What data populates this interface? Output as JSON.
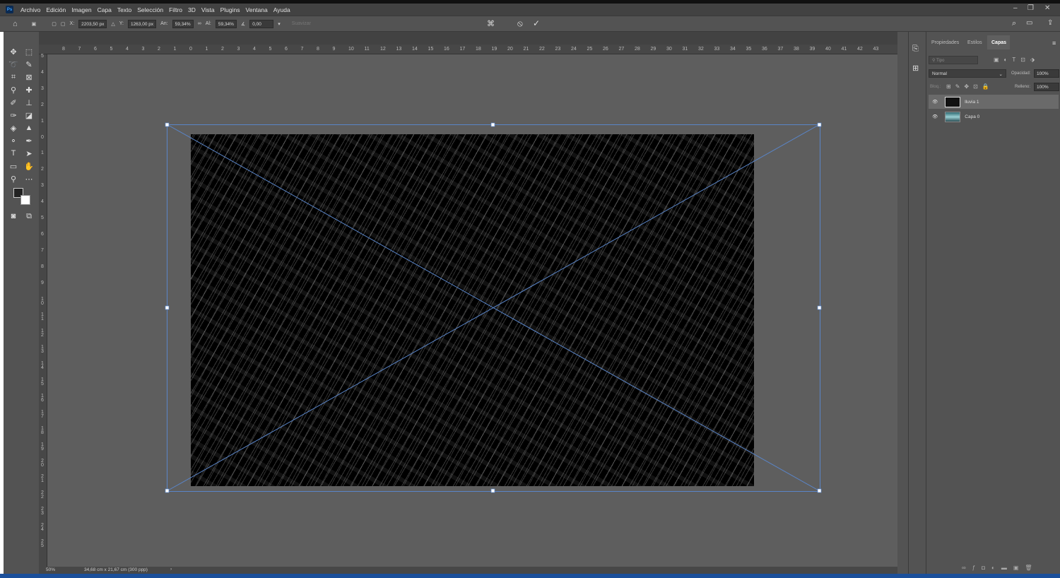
{
  "app": {
    "logo": "Ps"
  },
  "menu": [
    "Archivo",
    "Edición",
    "Imagen",
    "Capa",
    "Texto",
    "Selección",
    "Filtro",
    "3D",
    "Vista",
    "Plugins",
    "Ventana",
    "Ayuda"
  ],
  "options": {
    "x_label": "X:",
    "x_value": "2203,50 px",
    "y_label": "Y:",
    "y_value": "1263,00 px",
    "w_label": "An:",
    "w_value": "59,34%",
    "h_label": "Al:",
    "h_value": "59,34%",
    "angle_value": "0,00",
    "smooth_label": "Suavizar"
  },
  "rulers": {
    "horizontal": [
      "8",
      "7",
      "6",
      "5",
      "4",
      "3",
      "2",
      "1",
      "0",
      "1",
      "2",
      "3",
      "4",
      "5",
      "6",
      "7",
      "8",
      "9",
      "10",
      "11",
      "12",
      "13",
      "14",
      "15",
      "16",
      "17",
      "18",
      "19",
      "20",
      "21",
      "22",
      "23",
      "24",
      "25",
      "26",
      "27",
      "28",
      "29",
      "30",
      "31",
      "32",
      "33",
      "34",
      "35",
      "36",
      "37",
      "38",
      "39",
      "40",
      "41",
      "42",
      "43"
    ],
    "vertical": [
      "5",
      "4",
      "3",
      "2",
      "1",
      "0",
      "1",
      "2",
      "3",
      "4",
      "5",
      "6",
      "7",
      "8",
      "9",
      "10",
      "11",
      "12",
      "13",
      "14",
      "15",
      "16",
      "17",
      "18",
      "19",
      "20",
      "21",
      "22",
      "23",
      "24",
      "25"
    ]
  },
  "status": {
    "zoom": "50%",
    "doc_size": "34,68 cm x 21,67 cm (300 ppp)"
  },
  "panel": {
    "tabs": [
      "Propiedades",
      "Estilos",
      "Capas"
    ],
    "active_tab": "Capas",
    "filter_placeholder": "Tipo",
    "blend_mode": "Normal",
    "opacity_label": "Opacidad:",
    "opacity_value": "100%",
    "lock_label": "Bloq.:",
    "fill_label": "Relleno:",
    "fill_value": "100%",
    "layers": [
      {
        "name": "lluvia 1",
        "selected": true
      },
      {
        "name": "Capa 0",
        "selected": false
      }
    ]
  }
}
